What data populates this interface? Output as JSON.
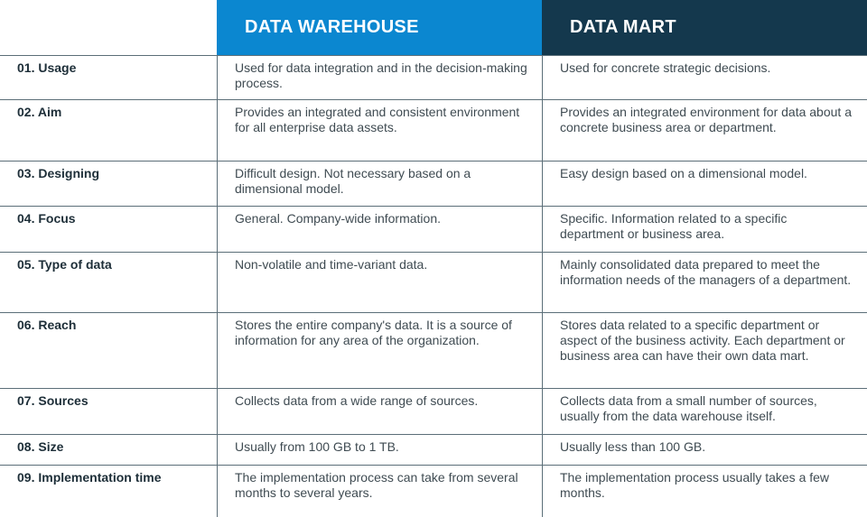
{
  "header": {
    "col_warehouse": "DATA WAREHOUSE",
    "col_mart": "DATA MART"
  },
  "colors": {
    "warehouse_header": "#0b87d0",
    "mart_header": "#14384d",
    "grid_lines": "#5b6e78"
  },
  "rows": [
    {
      "label": "01. Usage",
      "warehouse": "Used for data integration and in the decision-making process.",
      "mart": "Used for concrete strategic decisions."
    },
    {
      "label": "02. Aim",
      "warehouse": "Provides an integrated and consistent environment for all enterprise data assets.",
      "mart": "Provides an integrated environment for data about a concrete business area or department."
    },
    {
      "label": "03. Designing",
      "warehouse": "Difficult design. Not necessary based on a dimensional model.",
      "mart": "Easy design based on a dimensional model."
    },
    {
      "label": "04. Focus",
      "warehouse": "General. Company-wide information.",
      "mart": "Specific. Information related to a specific department or business area."
    },
    {
      "label": "05. Type of data",
      "warehouse": "Non-volatile and time-variant data.",
      "mart": "Mainly consolidated data prepared to meet the information needs of the managers of a department."
    },
    {
      "label": "06. Reach",
      "warehouse": "Stores the entire company's data. It is a source of information for any area of the organization.",
      "mart": "Stores data related to a specific department or aspect of the business activity. Each department or business area can have their own data mart."
    },
    {
      "label": "07. Sources",
      "warehouse": "Collects data from a wide range of sources.",
      "mart": "Collects data from a small number of sources, usually from the data warehouse itself."
    },
    {
      "label": "08. Size",
      "warehouse": "Usually from 100 GB to 1 TB.",
      "mart": "Usually less than 100 GB."
    },
    {
      "label": "09. Implementation time",
      "warehouse": "The implementation process can take from several months to several years.",
      "mart": "The implementation process usually takes a few months."
    }
  ]
}
